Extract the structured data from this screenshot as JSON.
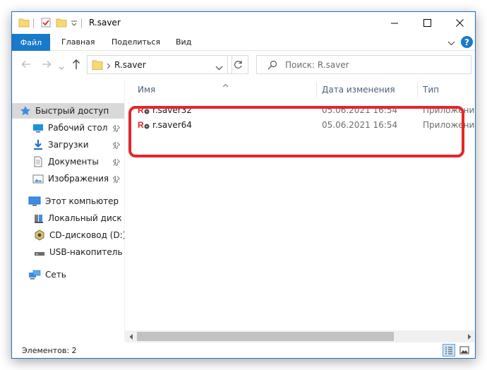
{
  "window": {
    "title": "R.saver",
    "controls": {
      "minimize": "minimize-icon",
      "maximize": "maximize-icon",
      "close": "close-icon"
    }
  },
  "ribbon": {
    "tabs": [
      {
        "label": "Файл",
        "active": true
      },
      {
        "label": "Главная"
      },
      {
        "label": "Поделиться"
      },
      {
        "label": "Вид"
      }
    ],
    "help": "?"
  },
  "address": {
    "path": "R.saver",
    "search_placeholder": "Поиск: R.saver"
  },
  "sidebar": {
    "quick_access": "Быстрый доступ",
    "pinned": [
      {
        "label": "Рабочий стол",
        "icon": "desktop-icon"
      },
      {
        "label": "Загрузки",
        "icon": "downloads-icon"
      },
      {
        "label": "Документы",
        "icon": "documents-icon"
      },
      {
        "label": "Изображения",
        "icon": "pictures-icon"
      }
    ],
    "this_pc": "Этот компьютер",
    "drives": [
      {
        "label": "Локальный диск (C",
        "icon": "hard-drive-icon"
      },
      {
        "label": "CD-дисковод (D:) V",
        "icon": "cd-drive-icon"
      },
      {
        "label": "USB-накопитель (E",
        "icon": "usb-drive-icon"
      }
    ],
    "network": "Сеть"
  },
  "columns": {
    "name": "Имя",
    "date": "Дата изменения",
    "type": "Тип"
  },
  "files": [
    {
      "name": "r.saver32",
      "date": "05.06.2021 16:54",
      "type": "Приложение"
    },
    {
      "name": "r.saver64",
      "date": "05.06.2021 16:54",
      "type": "Приложение"
    }
  ],
  "status": {
    "items": "Элементов: 2"
  },
  "colors": {
    "accent": "#1979ca",
    "highlight": "#e3262b",
    "folder": "#f8d775"
  }
}
